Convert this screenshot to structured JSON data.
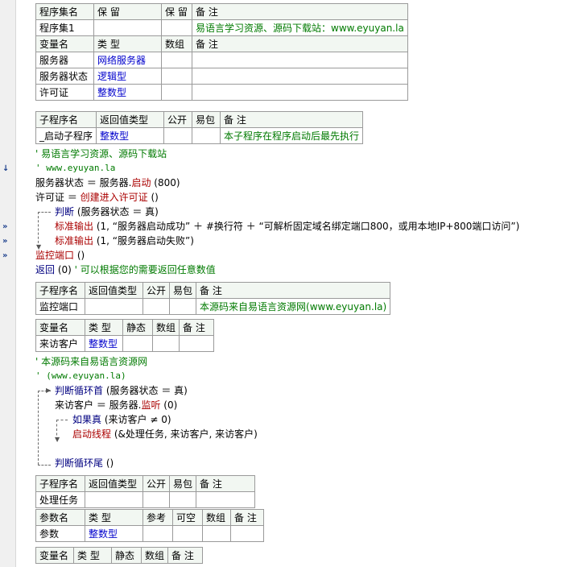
{
  "gutter_markers": [
    "↓",
    "»",
    "»",
    "»"
  ],
  "assembly_table": {
    "header": [
      "程序集名",
      "保 留",
      "保 留",
      "备 注"
    ],
    "row": [
      "程序集1",
      "",
      "",
      "易语言学习资源、源码下载站：www.eyuyan.la"
    ],
    "var_header": [
      "变量名",
      "类 型",
      "数组",
      "备 注"
    ],
    "vars": [
      [
        "服务器",
        "网络服务器",
        "",
        ""
      ],
      [
        "服务器状态",
        "逻辑型",
        "",
        ""
      ],
      [
        "许可证",
        "整数型",
        "",
        ""
      ]
    ]
  },
  "sub1_table": {
    "header": [
      "子程序名",
      "返回值类型",
      "公开",
      "易包",
      "备 注"
    ],
    "row": [
      "_启动子程序",
      "整数型",
      "",
      "",
      "本子程序在程序启动后最先执行"
    ]
  },
  "code1": {
    "comment1": "' 易语言学习资源、源码下载站",
    "comment2": "' www.eyuyan.la",
    "line_server_state": "服务器状态 ＝ 服务器.",
    "line_server_state_fn": "启动",
    "line_server_state_arg": " (800)",
    "line_license": "许可证 ＝ ",
    "line_license_fn": "创建进入许可证",
    "line_license_arg": " ()",
    "if_kw": "判断",
    "if_cond": " (服务器状态 ＝ 真)",
    "out1_fn": "标准输出",
    "out1_arg": " (1, “服务器启动成功” ＋ #换行符 ＋ “可解析固定域名绑定端口800，或用本地IP+800端口访问”)",
    "out2_fn": "标准输出",
    "out2_arg": " (1, “服务器启动失败”)",
    "monitor_call": "监控端口",
    "monitor_arg": " ()",
    "return_kw": "返回",
    "return_arg": " (0)  ",
    "return_comment": "' 可以根据您的需要返回任意数值"
  },
  "sub2_table": {
    "header": [
      "子程序名",
      "返回值类型",
      "公开",
      "易包",
      "备 注"
    ],
    "row": [
      "监控端口",
      "",
      "",
      "",
      "本源码来自易语言资源网(www.eyuyan.la)"
    ],
    "var_header": [
      "变量名",
      "类 型",
      "静态",
      "数组",
      "备 注"
    ],
    "vars": [
      [
        "来访客户",
        "整数型",
        "",
        "",
        ""
      ]
    ]
  },
  "code2": {
    "comment1": "' 本源码来自易语言资源网",
    "comment2": "' (www.eyuyan.la)",
    "loop_kw": "判断循环首",
    "loop_cond": " (服务器状态 ＝ 真)",
    "listen_line": "来访客户 ＝ 服务器.",
    "listen_fn": "监听",
    "listen_arg": " (0)",
    "ifa_kw": "如果真",
    "ifa_cond": " (来访客户 ≠ 0)",
    "thread_fn": "启动线程",
    "thread_arg": " (&处理任务, 来访客户, 来访客户)",
    "loop_end": "判断循环尾",
    "loop_end_arg": " ()"
  },
  "sub3_table": {
    "header": [
      "子程序名",
      "返回值类型",
      "公开",
      "易包",
      "备 注"
    ],
    "row": [
      "处理任务",
      "",
      "",
      "",
      ""
    ],
    "param_header": [
      "参数名",
      "类 型",
      "参考",
      "可空",
      "数组",
      "备 注"
    ],
    "params": [
      [
        "参数",
        "整数型",
        "",
        "",
        "",
        ""
      ]
    ]
  },
  "var3_table": {
    "header": [
      "变量名",
      "类 型",
      "静态",
      "数组",
      "备 注"
    ]
  }
}
